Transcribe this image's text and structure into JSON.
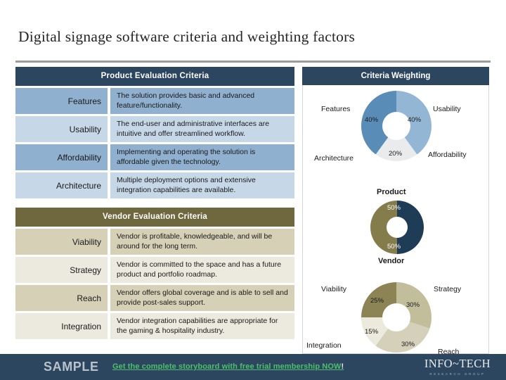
{
  "slide": {
    "title": "Digital signage software criteria and weighting factors"
  },
  "product_table": {
    "header": "Product Evaluation Criteria",
    "rows": [
      {
        "label": "Features",
        "description": "The solution provides basic and advanced feature/functionality."
      },
      {
        "label": "Usability",
        "description": "The end-user and administrative interfaces are intuitive and offer streamlined workflow."
      },
      {
        "label": "Affordability",
        "description": "Implementing and operating the solution is affordable given the technology."
      },
      {
        "label": "Architecture",
        "description": "Multiple deployment options and extensive integration capabilities are available."
      }
    ]
  },
  "vendor_table": {
    "header": "Vendor Evaluation Criteria",
    "rows": [
      {
        "label": "Viability",
        "description": "Vendor is profitable, knowledgeable, and will be around for the long term."
      },
      {
        "label": "Strategy",
        "description": "Vendor is committed to the space and has a future product and portfolio roadmap."
      },
      {
        "label": "Reach",
        "description": "Vendor offers global coverage and is able to sell and provide post-sales support."
      },
      {
        "label": "Integration",
        "description": "Vendor integration capabilities are appropriate for the gaming & hospitality industry."
      }
    ]
  },
  "weighting_panel": {
    "header": "Criteria Weighting"
  },
  "chart_data": [
    {
      "type": "pie",
      "title": "Product",
      "subtype": "donut",
      "labels": [
        "Usability",
        "Affordability",
        "Architecture",
        "Features"
      ],
      "segment_labels": [
        "Usability / Affordability",
        "Architecture",
        "Features"
      ],
      "values": [
        40,
        20,
        40
      ],
      "value_labels": [
        "40%",
        "20%",
        "40%"
      ],
      "colors": [
        "#93b6d4",
        "#e9ebec",
        "#5a8cb8"
      ],
      "legend_position": "around",
      "corner_labels": {
        "top_left": "Features",
        "top_right": "Usability",
        "bottom_right": "Affordability",
        "bottom_left": "Architecture"
      }
    },
    {
      "type": "pie",
      "subtype": "donut",
      "title": "Product / Vendor",
      "labels": [
        "Product",
        "Vendor"
      ],
      "values": [
        50,
        50
      ],
      "value_labels": [
        "50%",
        "50%"
      ],
      "colors": [
        "#1f3c56",
        "#857c4c"
      ],
      "top_title": "Product",
      "bottom_title": "Vendor"
    },
    {
      "type": "pie",
      "subtype": "donut",
      "title": "Vendor",
      "labels": [
        "Strategy",
        "Reach",
        "Integration",
        "Viability"
      ],
      "values": [
        30,
        30,
        15,
        25
      ],
      "value_labels": [
        "30%",
        "30%",
        "15%",
        "25%"
      ],
      "colors": [
        "#c2bd9b",
        "#d5d0b9",
        "#eceadd",
        "#8d8456"
      ],
      "corner_labels": {
        "top_left": "Viability",
        "top_right": "Strategy",
        "bottom_right": "Reach",
        "bottom_left": "Integration"
      }
    }
  ],
  "footer": {
    "sample": "SAMPLE",
    "cta": "Get the complete storyboard with free trial membership NOW",
    "cta_bang": "!",
    "logo_main": "INFO~TECH",
    "logo_sub": "RESEARCH GROUP"
  }
}
